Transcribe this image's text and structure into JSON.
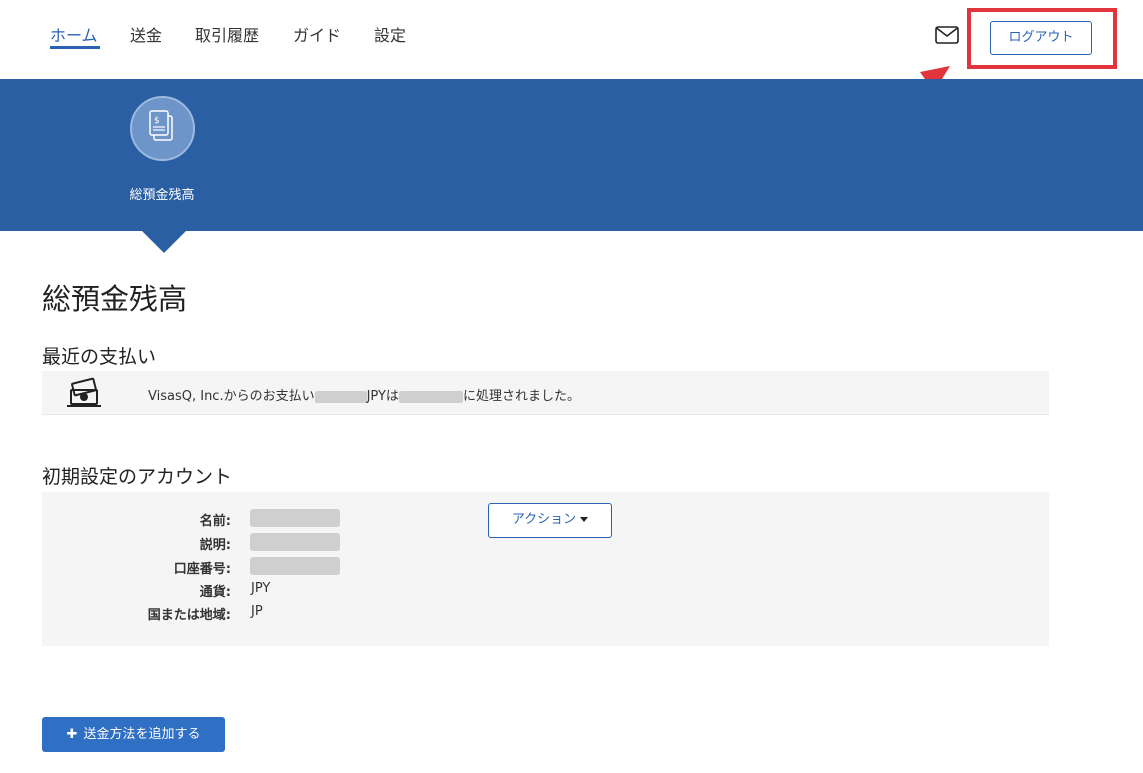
{
  "nav": {
    "items": [
      {
        "label": "ホーム",
        "active": true
      },
      {
        "label": "送金"
      },
      {
        "label": "取引履歴"
      },
      {
        "label": "ガイド"
      },
      {
        "label": "設定"
      }
    ],
    "mail_icon": "mail-icon",
    "logout_label": "ログアウト"
  },
  "banner": {
    "icon": "document-dollar-icon",
    "label": "総預金残高"
  },
  "main": {
    "title": "総預金残高",
    "recent_payments_title": "最近の支払い",
    "payment": {
      "icon": "money-icon",
      "text_prefix": "VisasQ, Inc.からのお支払い",
      "text_mid": "JPYは",
      "text_suffix": "に処理されました。"
    },
    "default_account_title": "初期設定のアカウント",
    "account": {
      "name_label": "名前:",
      "description_label": "説明:",
      "account_number_label": "口座番号:",
      "currency_label": "通貨:",
      "currency_value": "JPY",
      "country_label": "国または地域:",
      "country_value": "JP",
      "action_label": "アクション"
    },
    "add_method_label": "送金方法を追加する"
  },
  "colors": {
    "brand_blue": "#2a5fa4",
    "link_blue": "#2a63b4",
    "highlight_red": "#e2343c"
  }
}
